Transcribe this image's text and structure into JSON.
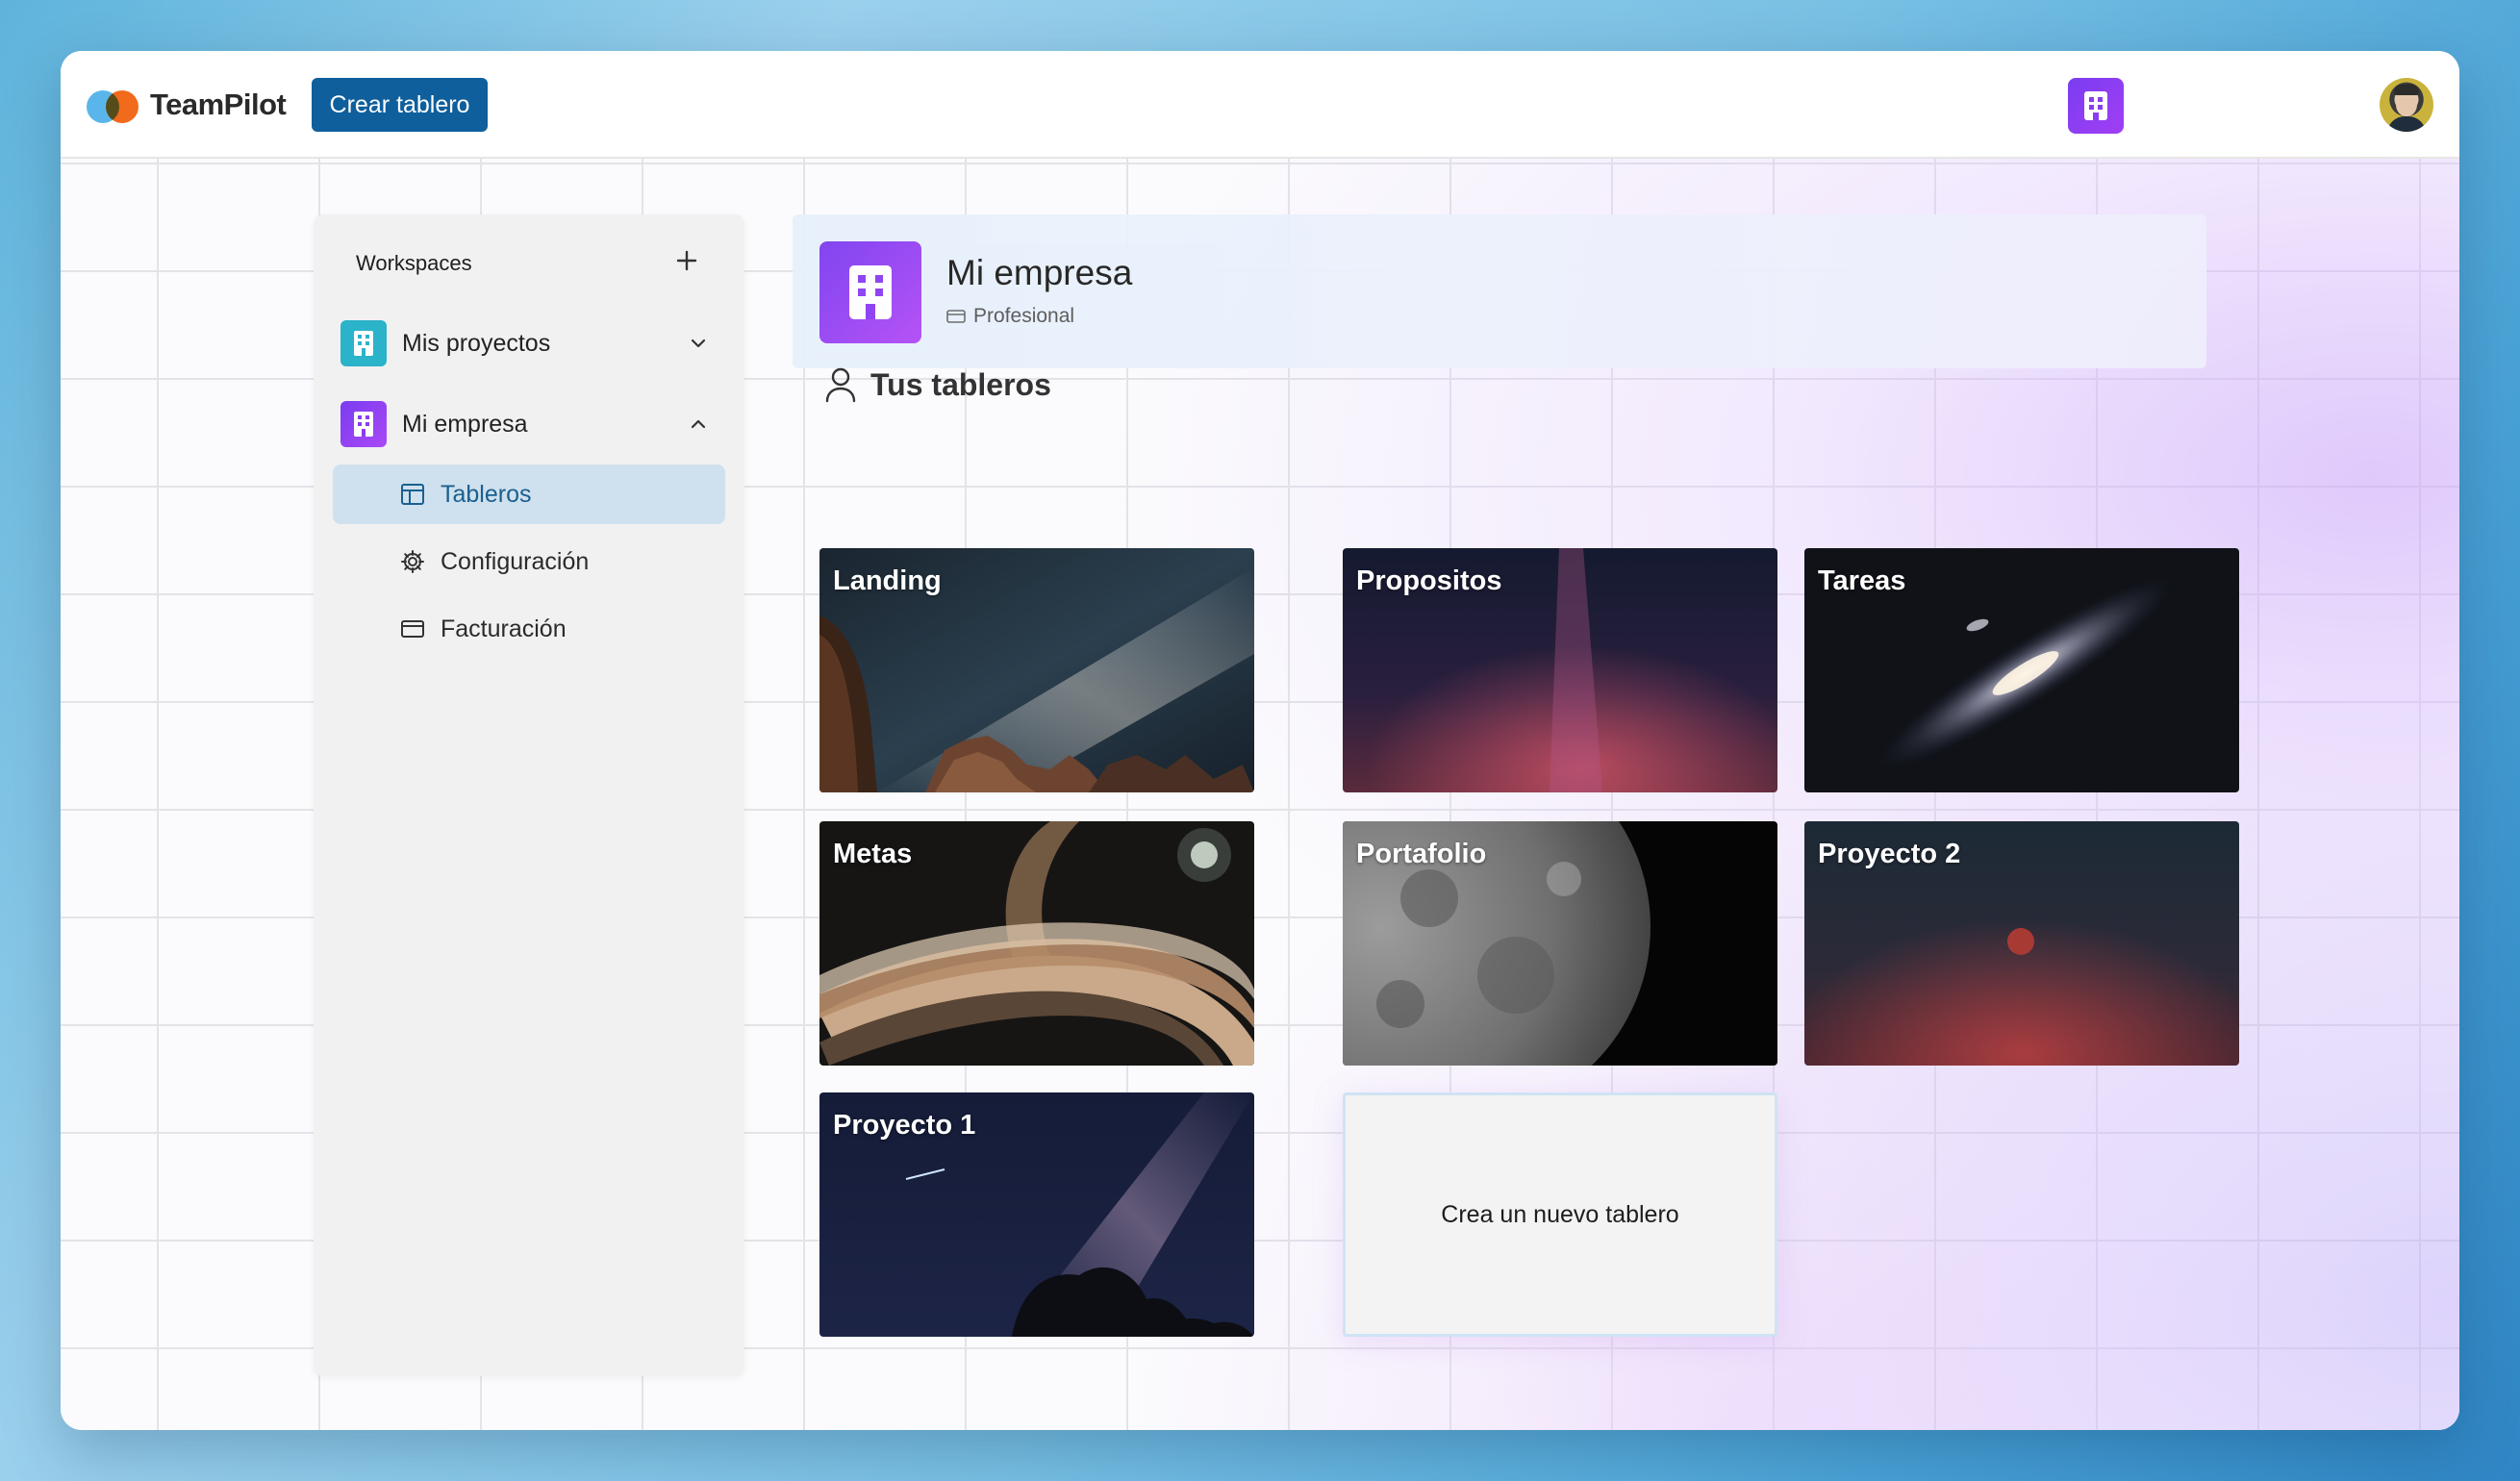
{
  "app": {
    "name": "TeamPilot",
    "create_board_label": "Crear tablero",
    "org_icon": "building-icon",
    "user_avatar": "user-avatar"
  },
  "sidebar": {
    "heading": "Workspaces",
    "add_icon": "plus-icon",
    "workspaces": [
      {
        "label": "Mis proyectos",
        "icon": "building-icon",
        "color": "#2bb3c9",
        "expanded": false
      },
      {
        "label": "Mi empresa",
        "icon": "building-icon",
        "color": "#8a3cf2",
        "expanded": true
      }
    ],
    "sub_items": [
      {
        "label": "Tableros",
        "icon": "board-icon",
        "active": true
      },
      {
        "label": "Configuración",
        "icon": "gear-icon",
        "active": false
      },
      {
        "label": "Facturación",
        "icon": "credit-card-icon",
        "active": false
      }
    ]
  },
  "org": {
    "name": "Mi empresa",
    "plan": "Profesional",
    "plan_icon": "credit-card-icon"
  },
  "boards_section": {
    "title": "Tus tableros",
    "title_icon": "user-icon",
    "boards": [
      {
        "name": "Landing",
        "image": "milky-way-over-rocks"
      },
      {
        "name": "Propositos",
        "image": "red-milky-way"
      },
      {
        "name": "Tareas",
        "image": "galaxy"
      },
      {
        "name": "Metas",
        "image": "ringed-planet"
      },
      {
        "name": "Portafolio",
        "image": "moon"
      },
      {
        "name": "Proyecto 2",
        "image": "red-nebula"
      },
      {
        "name": "Proyecto 1",
        "image": "starry-night-trees"
      }
    ],
    "new_board_label": "Crea un nuevo tablero"
  },
  "colors": {
    "primary": "#0f5f9c",
    "active_nav_bg": "#cfe1ee",
    "brand_purple": "#8a3cf2",
    "brand_teal": "#2bb3c9"
  }
}
